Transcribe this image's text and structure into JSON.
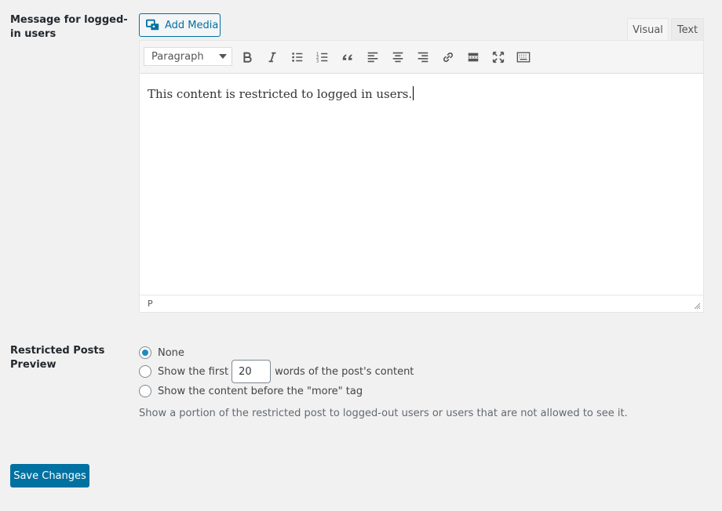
{
  "labels": {
    "logged_in_message": "Message for logged-in users",
    "restricted_preview": "Restricted Posts Preview"
  },
  "editor": {
    "add_media_label": "Add Media",
    "tabs": {
      "visual": "Visual",
      "text": "Text"
    },
    "format_select_value": "Paragraph",
    "toolbar_icons": [
      "bold-icon",
      "italic-icon",
      "bullet-list-icon",
      "numbered-list-icon",
      "blockquote-icon",
      "align-left-icon",
      "align-center-icon",
      "align-right-icon",
      "link-icon",
      "read-more-icon",
      "fullscreen-icon",
      "toolbar-toggle-icon"
    ],
    "content": "This content is restricted to logged in users.",
    "path": "P"
  },
  "preview_options": {
    "none_label": "None",
    "first_words_prefix": "Show the first",
    "first_words_value": "20",
    "first_words_suffix": "words of the post's content",
    "more_tag_label": "Show the content before the \"more\" tag",
    "selected": "none",
    "help_text": "Show a portion of the restricted post to logged-out users or users that are not allowed to see it."
  },
  "buttons": {
    "save_label": "Save Changes"
  },
  "colors": {
    "accent": "#0071a1",
    "radio_dot": "#1e8cbe",
    "background": "#f1f1f1"
  }
}
